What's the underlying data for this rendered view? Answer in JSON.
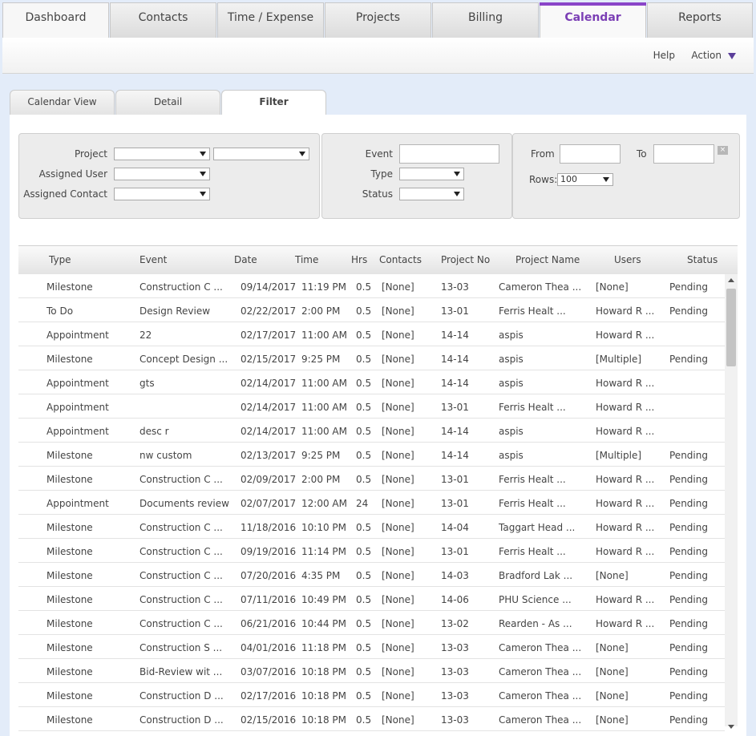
{
  "nav": {
    "tabs": [
      "Dashboard",
      "Contacts",
      "Time / Expense",
      "Projects",
      "Billing",
      "Calendar",
      "Reports"
    ],
    "active": "Calendar",
    "help": "Help",
    "action": "Action"
  },
  "subtabs": [
    "Calendar View",
    "Detail",
    "Filter"
  ],
  "filter": {
    "project_label": "Project",
    "assigned_user_label": "Assigned User",
    "assigned_contact_label": "Assigned Contact",
    "event_label": "Event",
    "type_label": "Type",
    "status_label": "Status",
    "from_label": "From",
    "to_label": "To",
    "rows_label": "Rows:",
    "rows_value": "100",
    "clear_glyph": "×"
  },
  "table": {
    "headers": [
      "Type",
      "Event",
      "Date",
      "Time",
      "Hrs",
      "Contacts",
      "Project No",
      "Project Name",
      "Users",
      "Status"
    ],
    "rows": [
      [
        "Milestone",
        "Construction C ...",
        "09/14/2017",
        "11:19 PM",
        "0.5",
        "[None]",
        "13-03",
        "Cameron Thea ...",
        "[None]",
        "Pending"
      ],
      [
        "To Do",
        "Design Review",
        "02/22/2017",
        "2:00 PM",
        "0.5",
        "[None]",
        "13-01",
        "Ferris Healt ...",
        "Howard R ...",
        "Pending"
      ],
      [
        "Appointment",
        "22",
        "02/17/2017",
        "11:00 AM",
        "0.5",
        "[None]",
        "14-14",
        "aspis",
        "Howard R ...",
        ""
      ],
      [
        "Milestone",
        "Concept Design ...",
        "02/15/2017",
        "9:25 PM",
        "0.5",
        "[None]",
        "14-14",
        "aspis",
        "[Multiple]",
        "Pending"
      ],
      [
        "Appointment",
        "gts",
        "02/14/2017",
        "11:00 AM",
        "0.5",
        "[None]",
        "14-14",
        "aspis",
        "Howard R ...",
        ""
      ],
      [
        "Appointment",
        "",
        "02/14/2017",
        "11:00 AM",
        "0.5",
        "[None]",
        "13-01",
        "Ferris Healt ...",
        "Howard R ...",
        ""
      ],
      [
        "Appointment",
        "desc r",
        "02/14/2017",
        "11:00 AM",
        "0.5",
        "[None]",
        "14-14",
        "aspis",
        "Howard R ...",
        ""
      ],
      [
        "Milestone",
        "nw custom",
        "02/13/2017",
        "9:25 PM",
        "0.5",
        "[None]",
        "14-14",
        "aspis",
        "[Multiple]",
        "Pending"
      ],
      [
        "Milestone",
        "Construction C ...",
        "02/09/2017",
        "2:00 PM",
        "0.5",
        "[None]",
        "13-01",
        "Ferris Healt ...",
        "Howard R ...",
        "Pending"
      ],
      [
        "Appointment",
        "Documents review",
        "02/07/2017",
        "12:00 AM",
        "24",
        "[None]",
        "13-01",
        "Ferris Healt ...",
        "Howard R ...",
        "Pending"
      ],
      [
        "Milestone",
        "Construction C ...",
        "11/18/2016",
        "10:10 PM",
        "0.5",
        "[None]",
        "14-04",
        "Taggart Head ...",
        "Howard R ...",
        "Pending"
      ],
      [
        "Milestone",
        "Construction C ...",
        "09/19/2016",
        "11:14 PM",
        "0.5",
        "[None]",
        "13-01",
        "Ferris Healt ...",
        "Howard R ...",
        "Pending"
      ],
      [
        "Milestone",
        "Construction C ...",
        "07/20/2016",
        "4:35 PM",
        "0.5",
        "[None]",
        "14-03",
        "Bradford Lak ...",
        "[None]",
        "Pending"
      ],
      [
        "Milestone",
        "Construction C ...",
        "07/11/2016",
        "10:49 PM",
        "0.5",
        "[None]",
        "14-06",
        "PHU Science ...",
        "Howard R ...",
        "Pending"
      ],
      [
        "Milestone",
        "Construction C ...",
        "06/21/2016",
        "10:44 PM",
        "0.5",
        "[None]",
        "13-02",
        "Rearden - As ...",
        "Howard R ...",
        "Pending"
      ],
      [
        "Milestone",
        "Construction S ...",
        "04/01/2016",
        "11:18 PM",
        "0.5",
        "[None]",
        "13-03",
        "Cameron Thea ...",
        "[None]",
        "Pending"
      ],
      [
        "Milestone",
        "Bid-Review wit ...",
        "03/07/2016",
        "10:18 PM",
        "0.5",
        "[None]",
        "13-03",
        "Cameron Thea ...",
        "[None]",
        "Pending"
      ],
      [
        "Milestone",
        "Construction D ...",
        "02/17/2016",
        "10:18 PM",
        "0.5",
        "[None]",
        "13-03",
        "Cameron Thea ...",
        "[None]",
        "Pending"
      ],
      [
        "Milestone",
        "Construction D ...",
        "02/15/2016",
        "10:18 PM",
        "0.5",
        "[None]",
        "13-03",
        "Cameron Thea ...",
        "[None]",
        "Pending"
      ]
    ]
  }
}
